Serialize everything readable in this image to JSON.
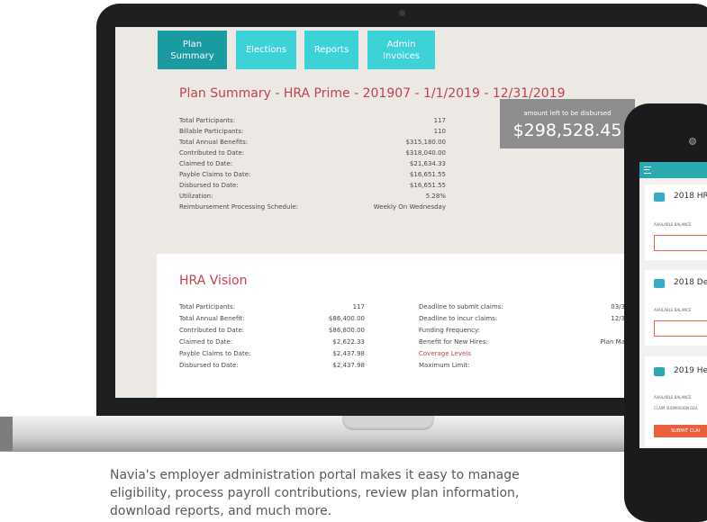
{
  "tabs": [
    {
      "label": "Plan\nSummary"
    },
    {
      "label": "Elections"
    },
    {
      "label": "Reports"
    },
    {
      "label": "Admin\nInvoices"
    }
  ],
  "plan_summary": {
    "title": "Plan Summary - HRA Prime - 201907 - 1/1/2019 - 12/31/2019",
    "rows": [
      {
        "label": "Total Participants:",
        "value": "117"
      },
      {
        "label": "Billable Participants:",
        "value": "110"
      },
      {
        "label": "Total Annual Benefits:",
        "value": "$315,180.00"
      },
      {
        "label": "Contributed to Date:",
        "value": "$318,040.00"
      },
      {
        "label": "Claimed to Date:",
        "value": "$21,634.33"
      },
      {
        "label": "Payble Claims to Date:",
        "value": "$16,651.55"
      },
      {
        "label": "Disbursed to Date:",
        "value": "$16,651.55"
      },
      {
        "label": "Utilization:",
        "value": "5.28%"
      },
      {
        "label": "Reimbursement Processing Schedule:",
        "value": "Weekly On Wednesday"
      }
    ],
    "amount_label": "amount left to be disbursed",
    "amount_value": "$298,528.45"
  },
  "hra_vision": {
    "title": "HRA Vision",
    "left_rows": [
      {
        "label": "Total Participants:",
        "value": "117"
      },
      {
        "label": "Total Annual Benefit:",
        "value": "$86,400.00"
      },
      {
        "label": "Contributed to Date:",
        "value": "$86,800.00"
      },
      {
        "label": "Claimed to Date:",
        "value": "$2,622.33"
      },
      {
        "label": "Payble Claims to Date:",
        "value": "$2,437.98"
      },
      {
        "label": "Disbursed to Date:",
        "value": "$2,437.98"
      }
    ],
    "right_rows": [
      {
        "label": "Deadline to submit claims:",
        "value": "03/3"
      },
      {
        "label": "Deadline to incur claims:",
        "value": "12/3"
      },
      {
        "label": "Funding Frequency:",
        "value": ""
      },
      {
        "label": "Benefit for New Hires:",
        "value": "Plan Ma"
      },
      {
        "label": "Coverage Levels",
        "value": ""
      },
      {
        "label": "Maximum Limit:",
        "value": ""
      }
    ]
  },
  "phone": {
    "cards": [
      {
        "title": "2018 HR",
        "small": "AVAILABLE BALANCE"
      },
      {
        "title": "2018 De",
        "small": "AVAILABLE BALANCE"
      },
      {
        "title": "2019 He",
        "small": "AVAILABLE BALANCE",
        "small2": "CLAIM SUBMISSION DEA",
        "button": "SUBMIT CLAI"
      }
    ]
  },
  "caption": "Navia's employer administration portal makes it easy to manage eligibility, process payroll contributions, review plan information, download reports, and much more.",
  "colors": {
    "teal": "#3dd2d8",
    "teal_active": "#1a9aa1",
    "red_title": "#c0434f",
    "orange": "#e8613c"
  }
}
